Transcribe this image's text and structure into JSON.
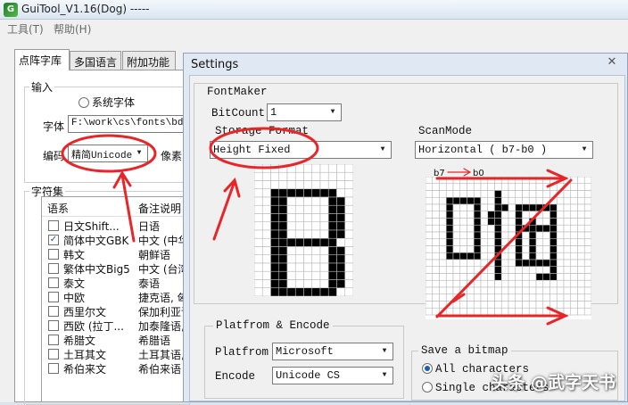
{
  "main": {
    "title": "GuiTool_V1.16(Dog) -----",
    "menu": [
      "工具(T)",
      "帮助(H)"
    ],
    "tabs": [
      "点阵字库",
      "多国语言",
      "附加功能"
    ],
    "input_group": "输入",
    "radio_system_font": "系统字体",
    "font_label": "字体",
    "font_path": "F:\\work\\cs\\fonts\\bdf\\",
    "encoding_label": "编码",
    "encoding_value": "精简Unicode",
    "pixel_label": "像素",
    "charset_group": "字符集",
    "columns": [
      "语系",
      "备注说明"
    ],
    "rows": [
      {
        "name": "日文Shift...",
        "note": "日语",
        "checked": false
      },
      {
        "name": "简体中文GBK",
        "note": "中文 (中华",
        "checked": true
      },
      {
        "name": "韩文",
        "note": "朝鲜语",
        "checked": false
      },
      {
        "name": "繁体中文Big5",
        "note": "中文 (台湾",
        "checked": false
      },
      {
        "name": "泰文",
        "note": "泰语",
        "checked": false
      },
      {
        "name": "中欧",
        "note": "捷克语, 匈",
        "checked": false
      },
      {
        "name": "西里尔文",
        "note": "保加利亚语",
        "checked": false
      },
      {
        "name": "西欧 (拉丁...",
        "note": "加泰隆语,",
        "checked": false
      },
      {
        "name": "希腊文",
        "note": "希腊语",
        "checked": false
      },
      {
        "name": "土耳其文",
        "note": "土耳其语,",
        "checked": false
      },
      {
        "name": "希伯来文",
        "note": "希伯来语",
        "checked": false
      }
    ]
  },
  "settings": {
    "title": "Settings",
    "fontmaker_group": "FontMaker",
    "bitcount_label": "BitCount",
    "bitcount_value": "1",
    "storage_label": "Storage Format",
    "storage_value": "Height Fixed",
    "scanmode_label": "ScanMode",
    "scanmode_value": "Horizontal ( b7-b0 )",
    "scan_annotation": "b7",
    "scan_annotation_end": "b0",
    "platform_group": "Platfrom & Encode",
    "platform_label": "Platfrom",
    "platform_value": "Microsoft",
    "encode_label": "Encode",
    "encode_value": "Unicode CS",
    "bitmap_group": "Save a bitmap",
    "radio_all": "All characters",
    "radio_single": "Single characters"
  },
  "watermark": "头条 @武字天书",
  "colors": {
    "annotation_red": "#e8262a",
    "pixel_black": "#000000",
    "grid_line": "#b8b8b8"
  },
  "icons": [
    "app-icon",
    "close-icon",
    "chevron-down-icon",
    "radio-icon",
    "checkbox-icon"
  ]
}
